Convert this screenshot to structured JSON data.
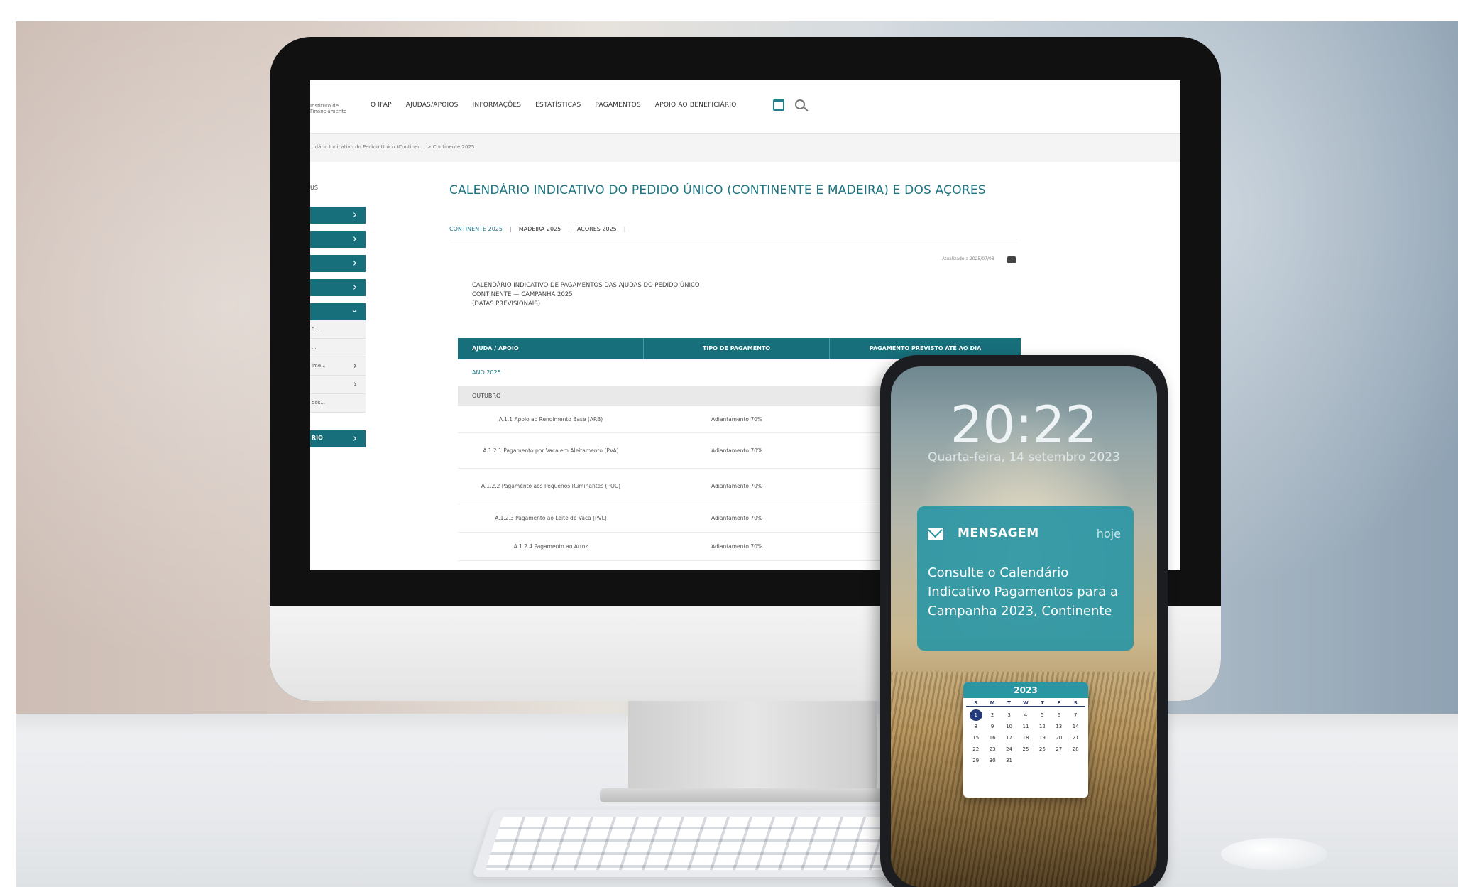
{
  "nav": {
    "logo_text": "Instituto de Financiamento",
    "items": [
      "O IFAP",
      "AJUDAS/APOIOS",
      "INFORMAÇÕES",
      "ESTATÍSTICAS",
      "PAGAMENTOS",
      "APOIO AO BENEFICIÁRIO"
    ]
  },
  "breadcrumb": "...dário Indicativo do Pedido Único (Continen... > Continente 2025",
  "sidebar": {
    "top_label": "US",
    "sub_items": [
      "o...",
      "...",
      "ime...",
      "",
      "dos..."
    ],
    "bottom_label": "RIO"
  },
  "main": {
    "title": "CALENDÁRIO INDICATIVO DO PEDIDO ÚNICO (CONTINENTE E MADEIRA) E DOS AÇORES",
    "tabs": [
      "CONTINENTE 2025",
      "MADEIRA 2025",
      "AÇORES 2025"
    ],
    "updated": "Atualizado a 2025/07/08",
    "heading_line1": "CALENDÁRIO INDICATIVO DE PAGAMENTOS DAS AJUDAS DO PEDIDO ÚNICO",
    "heading_line2": "CONTINENTE — CAMPANHA 2025",
    "heading_line3": "(DATAS PREVISIONAIS)",
    "table": {
      "headers": [
        "AJUDA / APOIO",
        "TIPO DE PAGAMENTO",
        "PAGAMENTO PREVISTO ATÉ AO DIA"
      ],
      "year_row": "ANO 2025",
      "month_row": "OUTUBRO",
      "rows": [
        {
          "aid": "A.1.1 Apoio ao Rendimento Base (ARB)",
          "type": "Adiantamento 70%",
          "date": ""
        },
        {
          "aid": "A.1.2.1 Pagamento por Vaca em Aleitamento (PVA)",
          "type": "Adiantamento 70%",
          "date": ""
        },
        {
          "aid": "A.1.2.2 Pagamento aos Pequenos Ruminantes (POC)",
          "type": "Adiantamento 70%",
          "date": ""
        },
        {
          "aid": "A.1.2.3 Pagamento ao Leite de Vaca (PVL)",
          "type": "Adiantamento 70%",
          "date": ""
        },
        {
          "aid": "A.1.2.4 Pagamento ao Arroz",
          "type": "Adiantamento 70%",
          "date": ""
        }
      ]
    }
  },
  "phone": {
    "time": "20:22",
    "date": "Quarta-feira, 14 setembro 2023",
    "notification": {
      "app": "MENSAGEM",
      "when": "hoje",
      "message": "Consulte o Calendário Indicativo Pagamentos para a Campanha 2023, Continente"
    },
    "calendar": {
      "year": "2023",
      "weekdays": [
        "S",
        "M",
        "T",
        "W",
        "T",
        "F",
        "S"
      ],
      "weeks": [
        [
          "1",
          "2",
          "3",
          "4",
          "5",
          "6",
          "7"
        ],
        [
          "8",
          "9",
          "10",
          "11",
          "12",
          "13",
          "14"
        ],
        [
          "15",
          "16",
          "17",
          "18",
          "19",
          "20",
          "21"
        ],
        [
          "22",
          "23",
          "24",
          "25",
          "26",
          "27",
          "28"
        ],
        [
          "29",
          "30",
          "31",
          "",
          "",
          "",
          ""
        ]
      ]
    }
  },
  "colors": {
    "brand_teal": "#176f7b",
    "notification_teal": "#2a96a4",
    "calendar_today": "#253a7a"
  }
}
